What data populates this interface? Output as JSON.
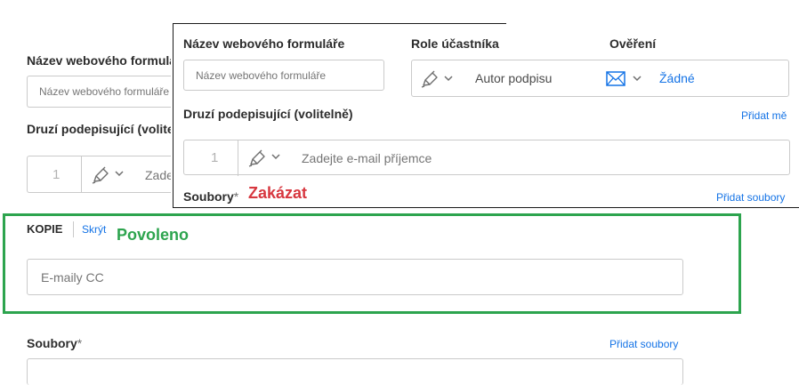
{
  "background_form": {
    "form_name_label": "Název webového formuláře",
    "form_name_placeholder": "Název webového formuláře",
    "signers_label": "Druzí podepisující (volitelně)",
    "signer_index": "1",
    "signer_email_placeholder": "Zadejte e-mail příjemce",
    "copy_label": "KOPIE",
    "hide_link": "Skrýt",
    "cc_placeholder": "E-maily CC",
    "files_label": "Soubory",
    "files_required": "*",
    "add_files_link": "Přidat soubory"
  },
  "overlay_form": {
    "form_name_label": "Název webového formuláře",
    "form_name_placeholder": "Název webového formuláře",
    "role_label": "Role účastníka",
    "role_value": "Autor podpisu",
    "verification_label": "Ověření",
    "verification_value": "Žádné",
    "signers_label": "Druzí podepisující (volitelně)",
    "add_me_link": "Přidat mě",
    "signer_index": "1",
    "signer_email_placeholder": "Zadejte e-mail příjemce",
    "files_label": "Soubory",
    "files_required": "*",
    "add_files_link": "Přidat soubory"
  },
  "annotations": {
    "disabled_text": "Zakázat",
    "enabled_text": "Povoleno",
    "disabled_color": "#d7373f",
    "enabled_color": "#2da44e"
  },
  "colors": {
    "link": "#1473e6",
    "highlight_border": "#2da44e"
  },
  "icons": {
    "pen": "pen-icon",
    "chevron": "chevron-down-icon",
    "mail": "mail-icon"
  }
}
